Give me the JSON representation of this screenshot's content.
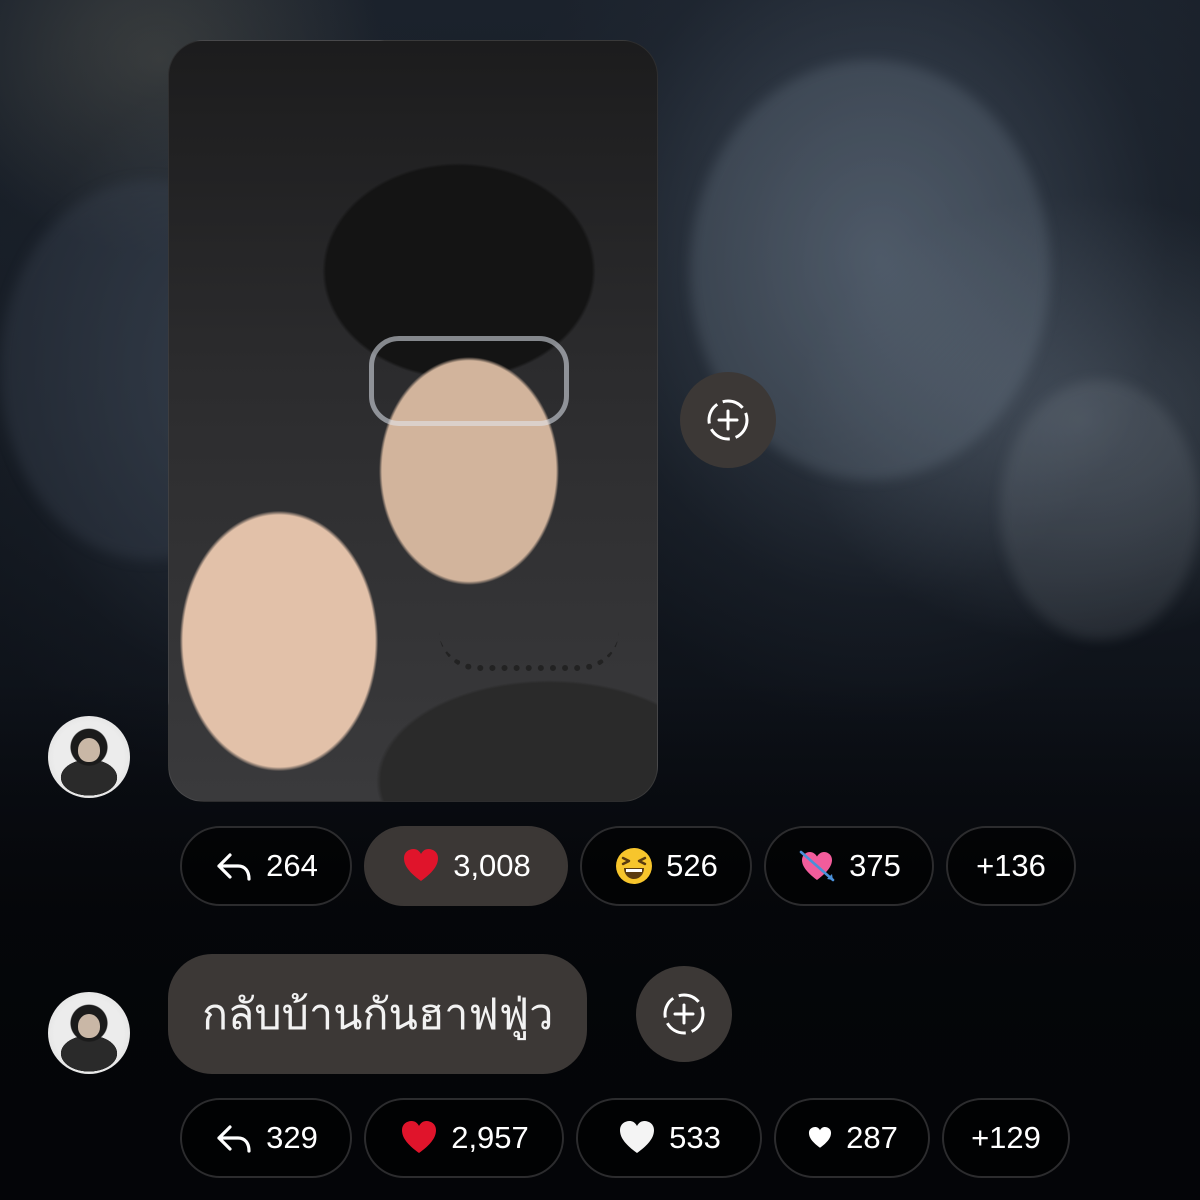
{
  "messages": [
    {
      "type": "photo",
      "reactions": [
        {
          "icon": "reply-icon",
          "count": "264"
        },
        {
          "icon": "red-heart-icon",
          "count": "3,008",
          "selected": true
        },
        {
          "icon": "grinning-squinting-face-icon",
          "count": "526"
        },
        {
          "icon": "heart-with-arrow-icon",
          "count": "375"
        },
        {
          "icon": "",
          "count": "+136"
        }
      ]
    },
    {
      "type": "text",
      "text": "กลับบ้านกันฮาฟฟู่ว",
      "reactions": [
        {
          "icon": "reply-icon",
          "count": "329"
        },
        {
          "icon": "red-heart-icon",
          "count": "2,957"
        },
        {
          "icon": "white-heart-icon",
          "count": "533"
        },
        {
          "icon": "small-white-heart-icon",
          "count": "287"
        },
        {
          "icon": "",
          "count": "+129"
        }
      ]
    }
  ],
  "colors": {
    "bubble": "#3c3836",
    "pill_border": "#2c2c2e",
    "heart_red": "#e0142b",
    "emoji_yellow": "#f7c52c",
    "heart_pink": "#f25c9b"
  }
}
